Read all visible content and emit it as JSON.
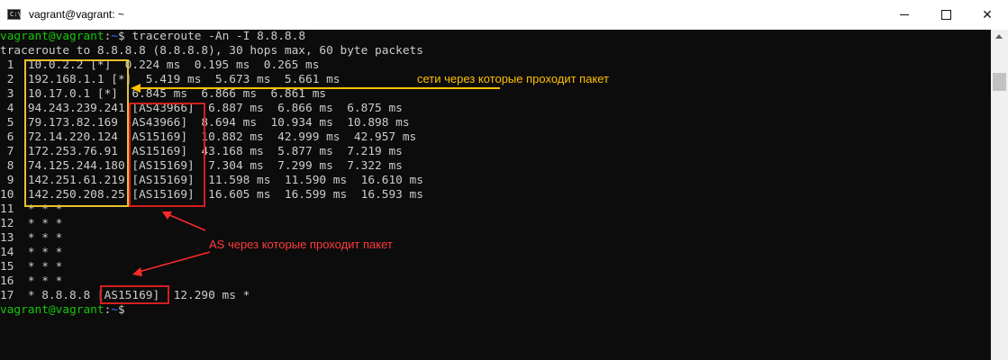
{
  "window": {
    "title": "vagrant@vagrant: ~",
    "icon_label": "C:\\"
  },
  "prompt": {
    "user_host": "vagrant@vagrant",
    "sep": ":",
    "path": "~",
    "symbol": "$",
    "command": " traceroute -An -I 8.8.8.8"
  },
  "output": {
    "header": "traceroute to 8.8.8.8 (8.8.8.8), 30 hops max, 60 byte packets",
    "hops": [
      " 1  10.0.2.2 [*]  0.224 ms  0.195 ms  0.265 ms",
      " 2  192.168.1.1 [*]  5.419 ms  5.673 ms  5.661 ms",
      " 3  10.17.0.1 [*]  6.845 ms  6.866 ms  6.861 ms",
      " 4  94.243.239.241 [AS43966]  6.887 ms  6.866 ms  6.875 ms",
      " 5  79.173.82.169 [AS43966]  8.694 ms  10.934 ms  10.898 ms",
      " 6  72.14.220.124 [AS15169]  10.882 ms  42.999 ms  42.957 ms",
      " 7  172.253.76.91 [AS15169]  43.168 ms  5.877 ms  7.219 ms",
      " 8  74.125.244.180 [AS15169]  7.304 ms  7.299 ms  7.322 ms",
      " 9  142.251.61.219 [AS15169]  11.598 ms  11.590 ms  16.610 ms",
      "10  142.250.208.25 [AS15169]  16.605 ms  16.599 ms  16.593 ms",
      "11  * * *",
      "12  * * *",
      "13  * * *",
      "14  * * *",
      "15  * * *",
      "16  * * *",
      "17  * 8.8.8.8 [AS15169]  12.290 ms *"
    ]
  },
  "annotations": {
    "networks": "сети через которые проходит пакет",
    "as": "AS через которые проходит пакет",
    "yellow_color": "#ffc000",
    "red_color": "#ff3b3b"
  }
}
